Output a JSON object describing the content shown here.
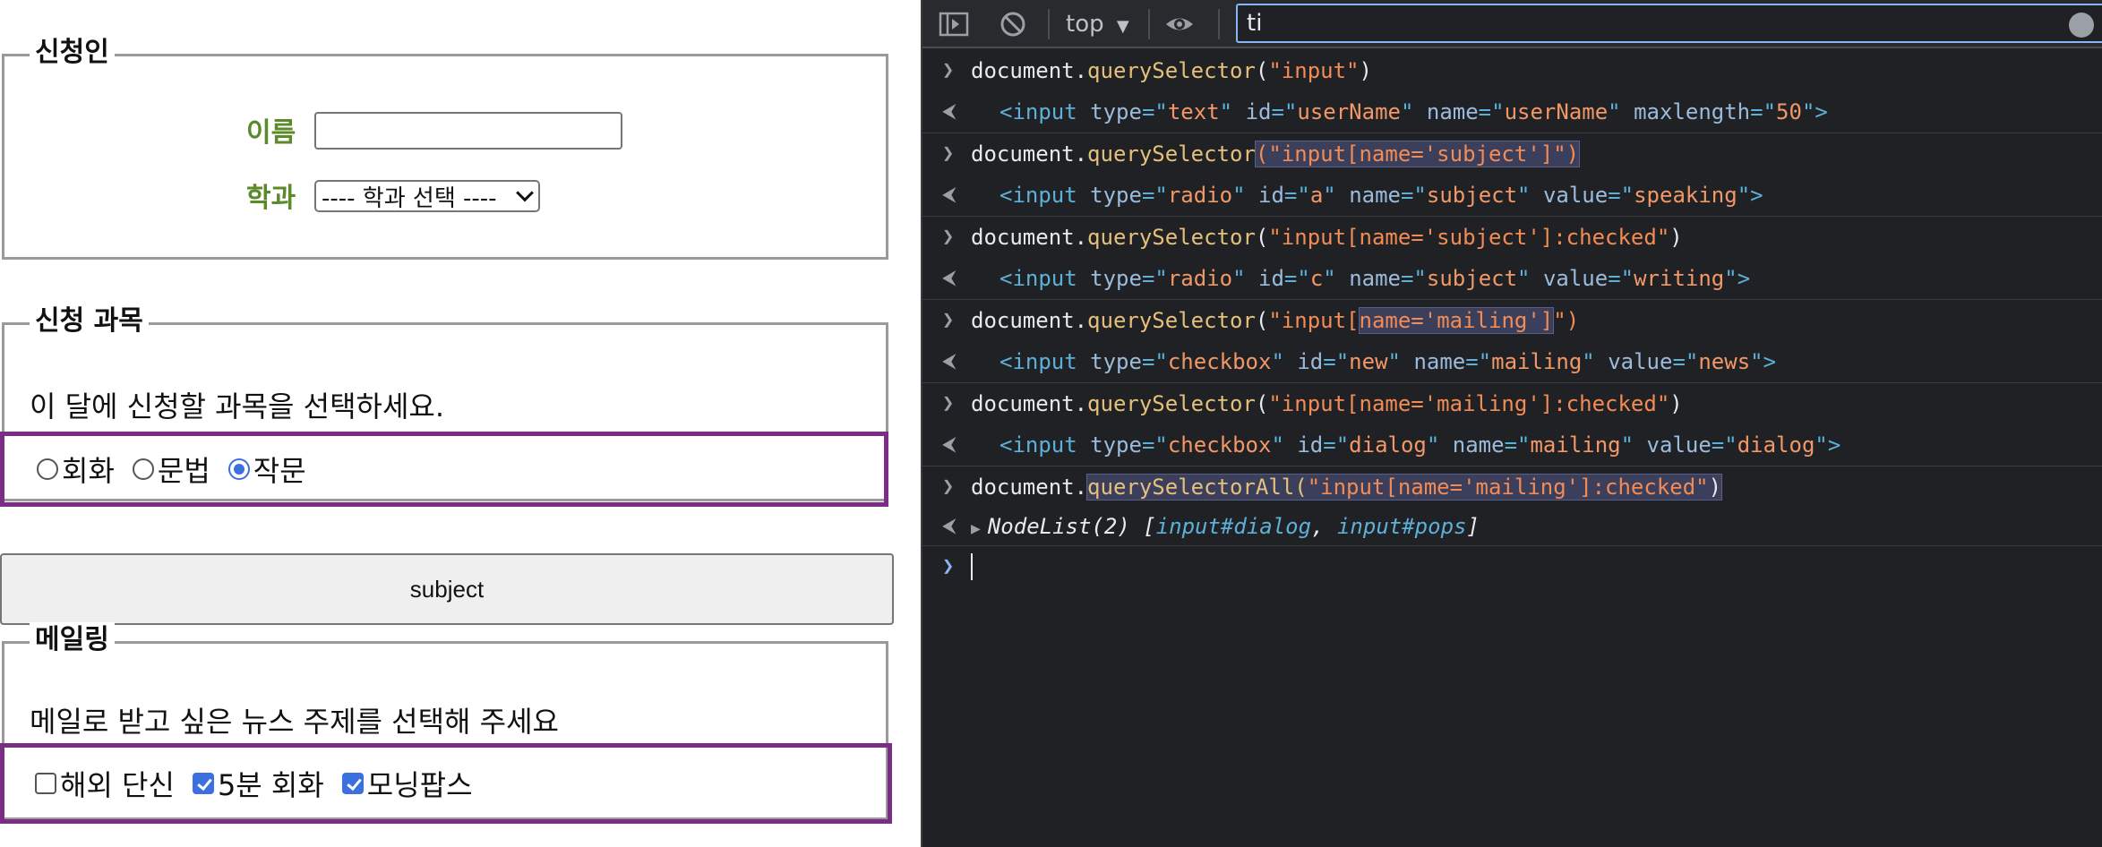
{
  "form": {
    "applicant": {
      "legend": "신청인",
      "name_label": "이름",
      "name_value": "",
      "dept_label": "학과",
      "dept_selected": "---- 학과 선택 ----"
    },
    "subjects": {
      "legend": "신청 과목",
      "intro": "이 달에 신청할 과목을 선택하세요.",
      "options": [
        {
          "label": "회화",
          "checked": false
        },
        {
          "label": "문법",
          "checked": false
        },
        {
          "label": "작문",
          "checked": true
        }
      ]
    },
    "subject_button": "subject",
    "mailing": {
      "legend": "메일링",
      "intro": "메일로 받고 싶은 뉴스 주제를 선택해 주세요",
      "options": [
        {
          "label": "해외 단신",
          "checked": false
        },
        {
          "label": "5분 회화",
          "checked": true
        },
        {
          "label": "모닝팝스",
          "checked": true
        }
      ]
    },
    "highlight_color": "#7b2d85"
  },
  "devtools": {
    "context": "top",
    "filter_value": "ti",
    "icons": [
      "sidebar-toggle-icon",
      "clear-console-icon",
      "dropdown-arrow-icon",
      "eye-icon",
      "clear-filter-icon"
    ],
    "entries": [
      {
        "input_parts": [
          "document.",
          "querySelector",
          "(",
          "\"input\"",
          ")"
        ],
        "output_parts": [
          "<input ",
          "type",
          "=\"",
          "text",
          "\" ",
          "id",
          "=\"",
          "userName",
          "\" ",
          "name",
          "=\"",
          "userName",
          "\" ",
          "maxlength",
          "=\"",
          "50",
          "\">"
        ]
      },
      {
        "input_parts": [
          "document.",
          "querySelector",
          "(\"input[name='subject']\")"
        ],
        "output_parts": [
          "<input ",
          "type",
          "=\"",
          "radio",
          "\" ",
          "id",
          "=\"",
          "a",
          "\" ",
          "name",
          "=\"",
          "subject",
          "\" ",
          "value",
          "=\"",
          "speaking",
          "\">"
        ]
      },
      {
        "input_parts": [
          "document.",
          "querySelector",
          "(",
          "\"input[name='subject']:checked\"",
          ")"
        ],
        "output_parts": [
          "<input ",
          "type",
          "=\"",
          "radio",
          "\" ",
          "id",
          "=\"",
          "c",
          "\" ",
          "name",
          "=\"",
          "subject",
          "\" ",
          "value",
          "=\"",
          "writing",
          "\">"
        ]
      },
      {
        "input_parts": [
          "document.",
          "querySelector",
          "(",
          "\"input[",
          "name='mailing']",
          "\")"
        ],
        "output_parts": [
          "<input ",
          "type",
          "=\"",
          "checkbox",
          "\" ",
          "id",
          "=\"",
          "new",
          "\" ",
          "name",
          "=\"",
          "mailing",
          "\" ",
          "value",
          "=\"",
          "news",
          "\">"
        ]
      },
      {
        "input_parts": [
          "document.",
          "querySelector",
          "(",
          "\"input[name='mailing']:checked\"",
          ")"
        ],
        "output_parts": [
          "<input ",
          "type",
          "=\"",
          "checkbox",
          "\" ",
          "id",
          "=\"",
          "dialog",
          "\" ",
          "name",
          "=\"",
          "mailing",
          "\" ",
          "value",
          "=\"",
          "dialog",
          "\">"
        ]
      },
      {
        "input_parts": [
          "document.",
          "querySelectorAll(",
          "\"input[name='mailing']:checked\"",
          ")"
        ],
        "output_parts": [
          "NodeList(2) [",
          "input#dialog",
          ", ",
          "input#pops",
          "]"
        ]
      }
    ]
  }
}
